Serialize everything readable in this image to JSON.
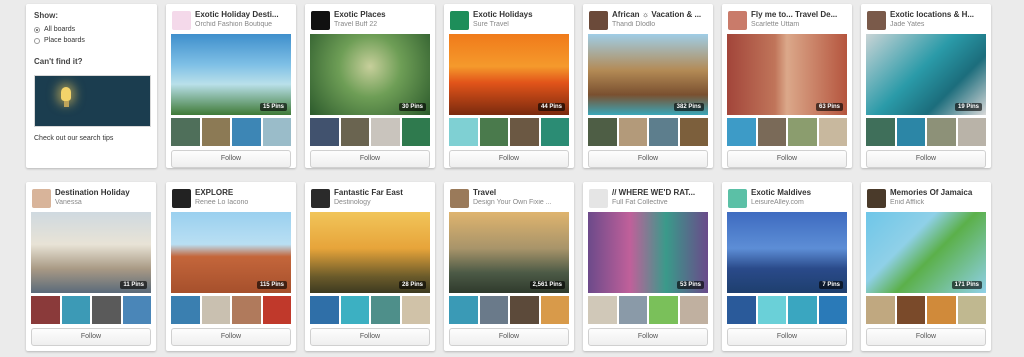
{
  "sidebar": {
    "show_label": "Show:",
    "options": [
      "All boards",
      "Place boards"
    ],
    "cant_find": "Can't find it?",
    "search_tips": "Check out our search tips"
  },
  "follow_label": "Follow",
  "boards": [
    {
      "title": "Exotic Holiday Desti...",
      "owner": "Orchid Fashion Boutique",
      "pins": "15 Pins",
      "avatar_bg": "#f4d9ea",
      "cover": "linear-gradient(180deg,#3f8fcc 0%,#7fc0e6 38%,#b9e0ea 62%,#3f7a37 100%)",
      "thumbs": [
        "#4f6f5a",
        "#8c7a55",
        "#3d86b5",
        "#9abcc9"
      ]
    },
    {
      "title": "Exotic Places",
      "owner": "Travel Buff 22",
      "pins": "30 Pins",
      "avatar_bg": "#111111",
      "cover": "radial-gradient(circle at 50% 40%,#c7cf9b 0%,#6e9e56 40%,#2c5a2c 100%)",
      "thumbs": [
        "#41526e",
        "#6a6450",
        "#c9c4bd",
        "#2f7a4e"
      ]
    },
    {
      "title": "Exotic Holidays",
      "owner": "Sure Travel",
      "pins": "44 Pins",
      "avatar_bg": "#1e8e5a",
      "cover": "linear-gradient(180deg,#f07a1a 0%,#f59a2c 40%,#e2541a 60%,#7a2a0e 100%)",
      "thumbs": [
        "#7fd0d3",
        "#4a7a4c",
        "#6b5843",
        "#2b8c74"
      ]
    },
    {
      "title": "African ☼ Vacation & ...",
      "owner": "Thandi Dlodlo",
      "pins": "382 Pins",
      "avatar_bg": "#6b4a3a",
      "cover": "linear-gradient(180deg,#9fcde6 0%,#b38a55 45%,#7a5030 75%,#3aa6b8 100%)",
      "thumbs": [
        "#4e5e45",
        "#b39a7a",
        "#5d7e8d",
        "#7c5f3c"
      ]
    },
    {
      "title": "Fly me to... Travel De...",
      "owner": "Scarlette Uttam",
      "pins": "63 Pins",
      "avatar_bg": "#c97b6a",
      "cover": "linear-gradient(90deg,#a2453a 0%,#c0755a 40%,#dba88a 50%,#b5553e 100%)",
      "thumbs": [
        "#3d9bc7",
        "#7a6a58",
        "#8b9d6e",
        "#c8b89e"
      ]
    },
    {
      "title": "Exotic locations & H...",
      "owner": "Jade Yates",
      "pins": "19 Pins",
      "avatar_bg": "#7a5a4a",
      "cover": "linear-gradient(135deg,#c9d4d6 0%,#2a9aa8 45%,#1c6d7c 70%,#d9d9d9 100%)",
      "thumbs": [
        "#3f6f5a",
        "#2c86a6",
        "#8d9178",
        "#b9b3a8"
      ]
    },
    {
      "title": "Destination Holiday",
      "owner": "Vanessa",
      "pins": "11 Pins",
      "avatar_bg": "#d8b49a",
      "cover": "linear-gradient(180deg,#cfd9e0 0%,#e8e3d6 40%,#a99a85 70%,#5a6a7a 100%)",
      "thumbs": [
        "#8a3a3a",
        "#3c9ab6",
        "#5a5a5a",
        "#4a86b8"
      ]
    },
    {
      "title": "EXPLORE",
      "owner": "Renee Lo Iacono",
      "pins": "115 Pins",
      "avatar_bg": "#222222",
      "cover": "linear-gradient(180deg,#9ad0ef 0%,#b9dff3 40%,#c4663b 55%,#a6502c 100%)",
      "thumbs": [
        "#3a7fb0",
        "#c9c0b0",
        "#b07a5c",
        "#c0392b"
      ]
    },
    {
      "title": "Fantastic Far East",
      "owner": "Destinology",
      "pins": "28 Pins",
      "avatar_bg": "#2a2a2a",
      "cover": "linear-gradient(180deg,#f1c55a 0%,#e7a43a 45%,#6a5a2a 80%,#3d3a20 100%)",
      "thumbs": [
        "#2f6fa8",
        "#3cb0c2",
        "#4e8f8a",
        "#d0c2a8"
      ]
    },
    {
      "title": "Travel",
      "owner": "Design Your Own Fixie ...",
      "pins": "2,561 Pins",
      "avatar_bg": "#9a7a5a",
      "cover": "linear-gradient(180deg,#dfb46e 0%,#a8946a 45%,#4c5a46 75%,#2f3a2c 100%)",
      "thumbs": [
        "#3a9ab6",
        "#6a7a8a",
        "#5c4a3a",
        "#d89a4a"
      ]
    },
    {
      "title": "// WHERE WE'D RAT...",
      "owner": "Full Fat Collective",
      "pins": "53 Pins",
      "avatar_bg": "#e5e5e5",
      "cover": "linear-gradient(90deg,#6c4a8a 0%,#c0609a 35%,#3a9a8a 65%,#6a4a8a 100%)",
      "thumbs": [
        "#d0c8b8",
        "#8a9aa8",
        "#7ac05a",
        "#c0b0a0"
      ]
    },
    {
      "title": "Exotic Maldives",
      "owner": "LeisureAlley.com",
      "pins": "7 Pins",
      "avatar_bg": "#5bc0a6",
      "cover": "linear-gradient(180deg,#3e6bc0 0%,#5d8ed6 45%,#2a4a8a 70%,#1e3f6e 100%)",
      "thumbs": [
        "#2a5a9a",
        "#6ad0d8",
        "#3aa6c0",
        "#2a7ab8"
      ]
    },
    {
      "title": "Memories Of Jamaica",
      "owner": "Enid Afflick",
      "pins": "171 Pins",
      "avatar_bg": "#4a3a2a",
      "cover": "linear-gradient(135deg,#6ec6e8 0%,#8fd0e8 35%,#5bb04a 55%,#8fd0e8 100%)",
      "thumbs": [
        "#c0a880",
        "#7a4a2a",
        "#d08a3a",
        "#c0b890"
      ]
    }
  ]
}
